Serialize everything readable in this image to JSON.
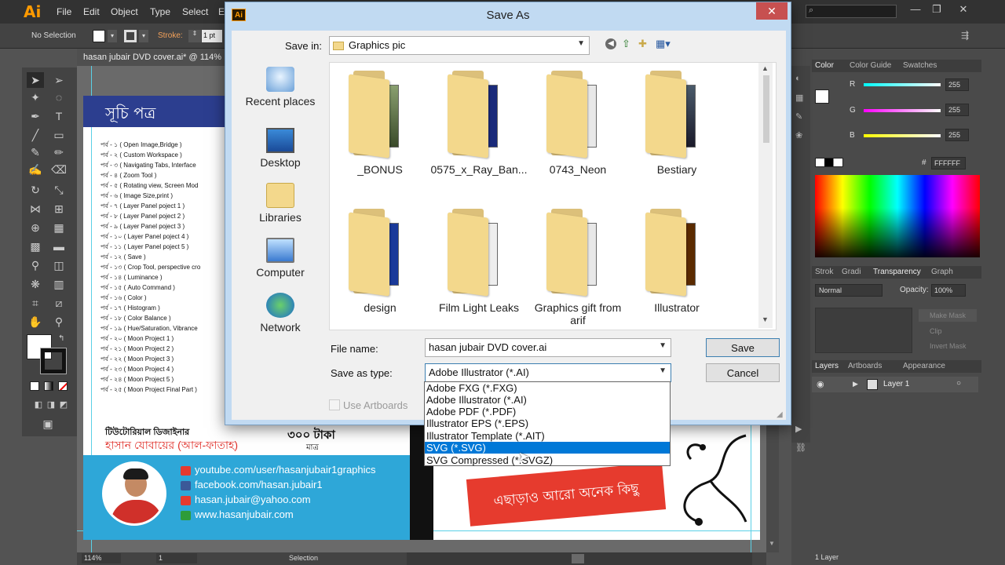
{
  "app": {
    "logo": "Ai",
    "menus": [
      "File",
      "Edit",
      "Object",
      "Type",
      "Select",
      "E"
    ],
    "window_controls": [
      "—",
      "❐",
      "✕"
    ]
  },
  "control_bar": {
    "selection": "No Selection",
    "stroke_label": "Stroke:",
    "stroke_value": "1 pt"
  },
  "document": {
    "tab_title": "hasan jubair DVD cover.ai* @ 114%"
  },
  "artwork": {
    "title": "সূচি পত্র",
    "toc": [
      "পর্ব - ১     ( Open Image,Bridge )",
      "পর্ব - ২     ( Custom Workspace )",
      "পর্ব - ৩     ( Navigating Tabs, Interface",
      "পর্ব - ৪     ( Zoom Tool )",
      "পর্ব - ৫     ( Rotating view, Screen Mod",
      "পর্ব - ৬     ( Image Size,print )",
      "পর্ব - ৭     ( Layer Panel poject 1 )",
      "পর্ব - ৮     ( Layer Panel poject  2 )",
      "পর্ব - ৯     ( Layer Panel poject 3 )",
      "পর্ব - ১০   ( Layer Panel poject 4 )",
      "পর্ব - ১১   ( Layer Panel poject 5 )",
      "পর্ব - ১২   ( Save )",
      "পর্ব - ১৩   ( Crop Tool, perspective cro",
      "পর্ব - ১৪   ( Luminance )",
      "পর্ব - ১৫   ( Auto Command )",
      "পর্ব - ১৬   ( Color )",
      "পর্ব - ১৭   ( Histogram )",
      "পর্ব - ১৮   ( Color Balance )",
      "পর্ব - ১৯   ( Hue/Saturation, Vibrance",
      "পর্ব - ২০   ( Moon Project 1 )",
      "পর্ব - ২১   ( Moon Project 2 )",
      "পর্ব - ২২   ( Moon Project 3 )",
      "পর্ব - ২৩   ( Moon Project 4 )",
      "পর্ব - ২৪   ( Moon Project 5 )",
      "পর্ব - ২৫   ( Moon Project Final Part )"
    ],
    "designer_label": "টিউটোরিয়াল ডিজাইনার",
    "designer_name": "হাসান যোবায়ের (আল-ফাতাহ)",
    "price": "৩০০ টাকা",
    "price_sub": "মাত্র",
    "contacts": [
      "youtube.com/user/hasanjubair1graphics",
      "facebook.com/hasan.jubair1",
      "hasan.jubair@yahoo.com",
      "www.hasanjubair.com"
    ],
    "banner": "এছাড়াও আরো অনেক কিছু"
  },
  "status_bar": {
    "zoom": "114%",
    "page": "1",
    "tool": "Selection"
  },
  "panels": {
    "color_tabs": [
      "Color",
      "Color Guide",
      "Swatches"
    ],
    "r_label": "R",
    "g_label": "G",
    "b_label": "B",
    "r_value": "255",
    "g_value": "255",
    "b_value": "255",
    "hex_label": "#",
    "hex_value": "FFFFFF",
    "mid_tabs": [
      "Strok",
      "Gradi",
      "Transparency",
      "Graph"
    ],
    "blend_mode": "Normal",
    "opacity_label": "Opacity:",
    "opacity_value": "100%",
    "make_mask": "Make Mask",
    "clip": "Clip",
    "invert_mask": "Invert Mask",
    "layer_tabs": [
      "Layers",
      "Artboards",
      "Appearance"
    ],
    "layer_name": "Layer 1",
    "layer_count": "1 Layer"
  },
  "dialog": {
    "title": "Save As",
    "close": "✕",
    "save_in_label": "Save in:",
    "save_in_value": "Graphics pic",
    "places": [
      "Recent places",
      "Desktop",
      "Libraries",
      "Computer",
      "Network"
    ],
    "folders": [
      "_BONUS",
      "0575_x_Ray_Ban...",
      "0743_Neon",
      "Bestiary",
      "design",
      "Film Light Leaks",
      "Graphics gift from arif",
      "Illustrator"
    ],
    "file_name_label": "File name:",
    "file_name_value": "hasan jubair DVD cover.ai",
    "save_type_label": "Save as type:",
    "save_type_value": "Adobe Illustrator (*.AI)",
    "use_artboards": "Use Artboards",
    "save_button": "Save",
    "cancel_button": "Cancel",
    "type_options": [
      "Adobe FXG (*.FXG)",
      "Adobe Illustrator (*.AI)",
      "Adobe PDF (*.PDF)",
      "Illustrator EPS (*.EPS)",
      "Illustrator Template (*.AIT)",
      "SVG (*.SVG)",
      "SVG Compressed (*.SVGZ)"
    ],
    "selected_option_index": 5
  }
}
